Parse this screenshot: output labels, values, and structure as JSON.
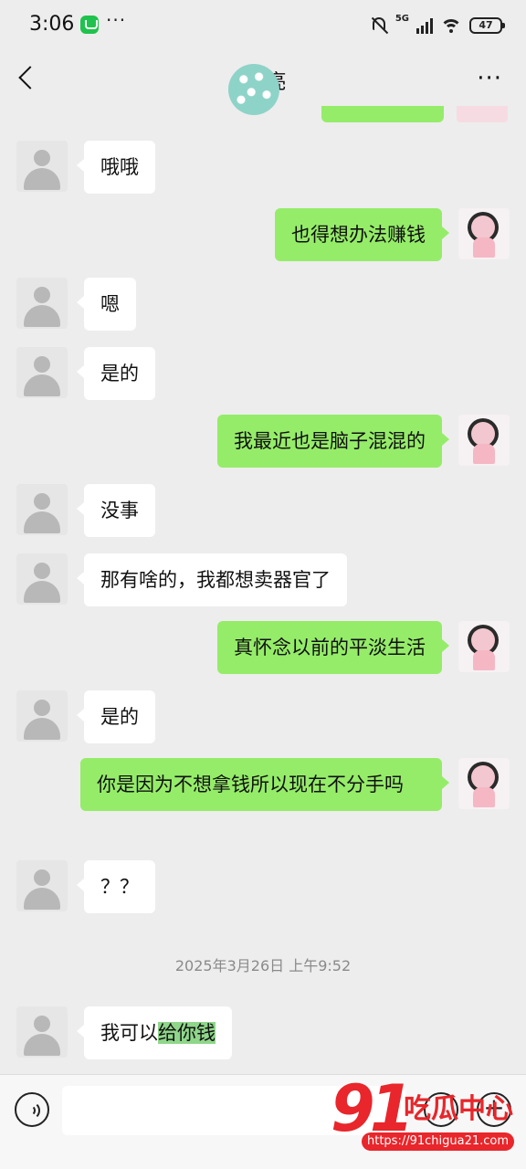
{
  "status_bar": {
    "time": "3:06",
    "more": "···",
    "network": "5G",
    "battery": "47"
  },
  "header": {
    "contact_name": "梓 亮",
    "more": "···"
  },
  "messages": [
    {
      "side": "in",
      "text": "哦哦"
    },
    {
      "side": "out",
      "text": "也得想办法赚钱"
    },
    {
      "side": "in",
      "text": "嗯"
    },
    {
      "side": "in",
      "text": "是的"
    },
    {
      "side": "out",
      "text": "我最近也是脑子混混的"
    },
    {
      "side": "in",
      "text": "没事"
    },
    {
      "side": "in",
      "text": "那有啥的，我都想卖器官了"
    },
    {
      "side": "out",
      "text": "真怀念以前的平淡生活"
    },
    {
      "side": "in",
      "text": "是的"
    },
    {
      "side": "out",
      "text": "你是因为不想拿钱所以现在不分手吗"
    },
    {
      "side": "in",
      "text": "？？"
    }
  ],
  "timestamp": "2025年3月26日 上午9:52",
  "last_message": {
    "side": "in",
    "prefix": "我可以",
    "highlighted": "给你钱"
  },
  "input_bar": {
    "placeholder": "",
    "plus": "+"
  },
  "watermark": {
    "number": "91",
    "name": "吃瓜中心",
    "url": "https://91chigua21.com"
  }
}
